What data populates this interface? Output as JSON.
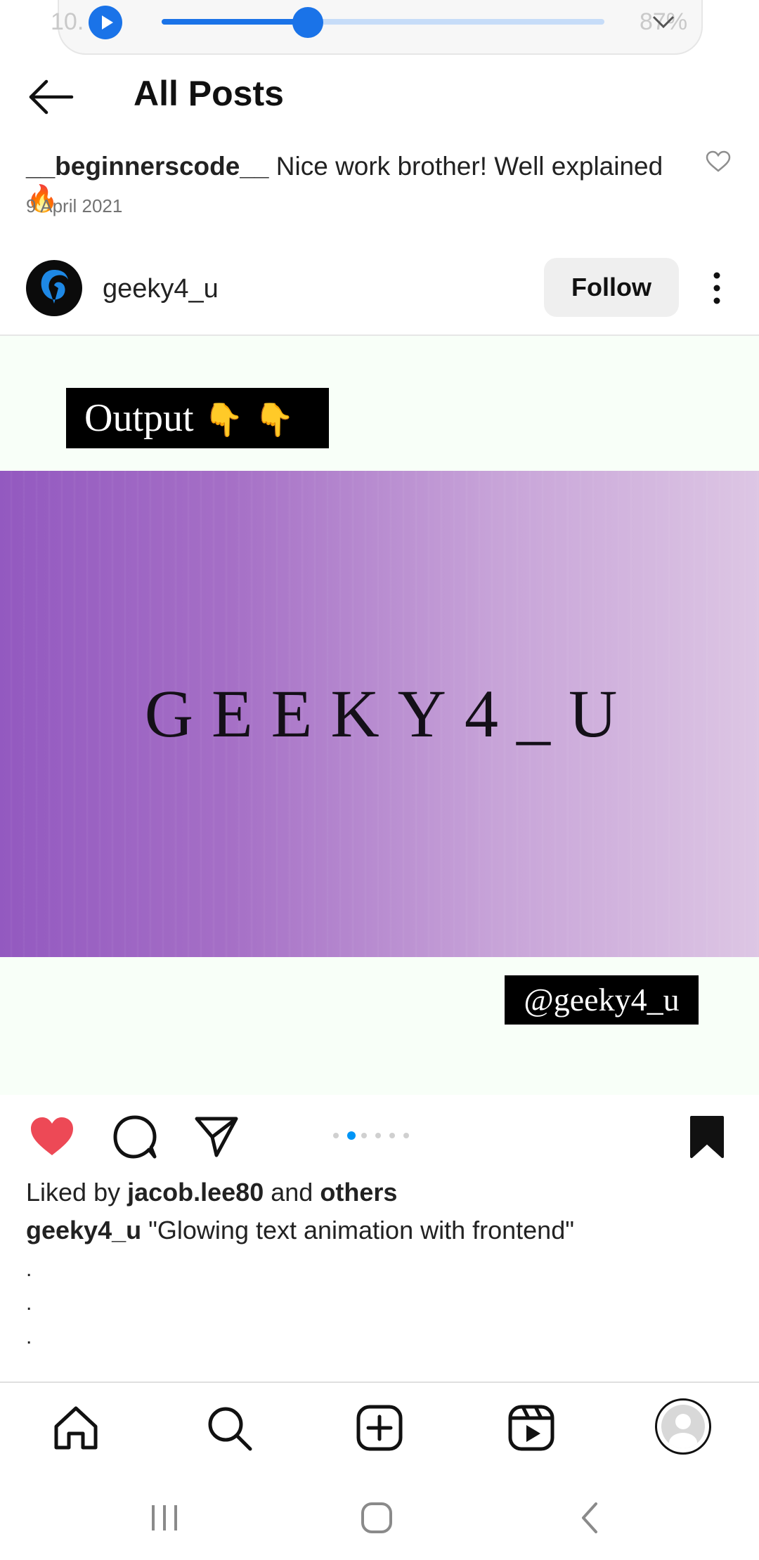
{
  "status_bar": {
    "time_partial": "10.",
    "battery_partial": "87%",
    "media_progress": 0.33
  },
  "header": {
    "title": "All Posts",
    "back_icon": "arrow-left-icon"
  },
  "comment": {
    "username": "__beginnerscode__",
    "text": "Nice work brother! Well explained",
    "emoji": "🔥",
    "date": "9 April 2021"
  },
  "post": {
    "username": "geeky4_u",
    "follow_label": "Follow",
    "image": {
      "output_label": "Output",
      "output_hands": "👇 👇",
      "brand_text": "GEEKY4_U",
      "handle_label": "@geeky4_u"
    },
    "carousel": {
      "count": 6,
      "active_index": 1
    },
    "liked_prefix": "Liked by",
    "liked_user": "jacob.lee80",
    "liked_and": "and",
    "liked_others": "others",
    "caption_user": "geeky4_u",
    "caption_text": "\"Glowing text animation with frontend\"",
    "caption_dots": [
      ".",
      ".",
      "."
    ]
  },
  "nav": {
    "items": [
      "home-icon",
      "search-icon",
      "create-post-icon",
      "reels-icon",
      "profile-avatar"
    ]
  },
  "colors": {
    "accent": "#0095f6",
    "like": "#ed4956",
    "media_blue": "#1a73e8"
  }
}
